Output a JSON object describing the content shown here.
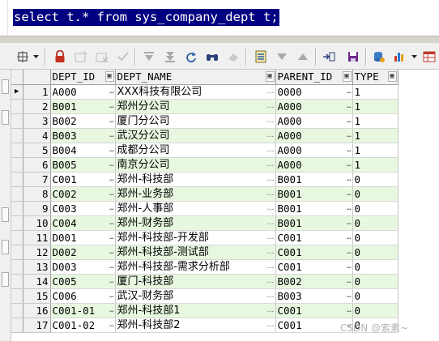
{
  "editor": {
    "sql": "select t.* from sys_company_dept t;"
  },
  "toolbar": {
    "icons": [
      "grid-options-icon",
      "lock-icon",
      "add-record-icon",
      "delete-record-icon",
      "post-changes-icon",
      "next-record-icon",
      "last-record-icon",
      "refresh-icon",
      "find-icon",
      "clear-icon",
      "query-by-example-icon",
      "filter-icon",
      "sort-icon",
      "export-icon",
      "save-icon",
      "fetch-icon",
      "chart-icon",
      "table-view-icon"
    ]
  },
  "grid": {
    "columns": [
      "DEPT_ID",
      "DEPT_NAME",
      "PARENT_ID",
      "TYPE"
    ],
    "rows": [
      {
        "n": "1",
        "dept_id": "A000",
        "dept_name": "XXX科技有限公司",
        "parent_id": "0000",
        "type": "1"
      },
      {
        "n": "2",
        "dept_id": "B001",
        "dept_name": "郑州分公司",
        "parent_id": "A000",
        "type": "1"
      },
      {
        "n": "3",
        "dept_id": "B002",
        "dept_name": "厦门分公司",
        "parent_id": "A000",
        "type": "1"
      },
      {
        "n": "4",
        "dept_id": "B003",
        "dept_name": "武汉分公司",
        "parent_id": "A000",
        "type": "1"
      },
      {
        "n": "5",
        "dept_id": "B004",
        "dept_name": "成都分公司",
        "parent_id": "A000",
        "type": "1"
      },
      {
        "n": "6",
        "dept_id": "B005",
        "dept_name": "南京分公司",
        "parent_id": "A000",
        "type": "1"
      },
      {
        "n": "7",
        "dept_id": "C001",
        "dept_name": "郑州-科技部",
        "parent_id": "B001",
        "type": "0"
      },
      {
        "n": "8",
        "dept_id": "C002",
        "dept_name": "郑州-业务部",
        "parent_id": "B001",
        "type": "0"
      },
      {
        "n": "9",
        "dept_id": "C003",
        "dept_name": "郑州-人事部",
        "parent_id": "B001",
        "type": "0"
      },
      {
        "n": "10",
        "dept_id": "C004",
        "dept_name": "郑州-财务部",
        "parent_id": "B001",
        "type": "0"
      },
      {
        "n": "11",
        "dept_id": "D001",
        "dept_name": "郑州-科技部-开发部",
        "parent_id": "C001",
        "type": "0"
      },
      {
        "n": "12",
        "dept_id": "D002",
        "dept_name": "郑州-科技部-测试部",
        "parent_id": "C001",
        "type": "0"
      },
      {
        "n": "13",
        "dept_id": "D003",
        "dept_name": "郑州-科技部-需求分析部",
        "parent_id": "C001",
        "type": "0"
      },
      {
        "n": "14",
        "dept_id": "C005",
        "dept_name": "厦门-科技部",
        "parent_id": "B002",
        "type": "0"
      },
      {
        "n": "15",
        "dept_id": "C006",
        "dept_name": "武汉-财务部",
        "parent_id": "B003",
        "type": "0"
      },
      {
        "n": "16",
        "dept_id": "C001-01",
        "dept_name": "郑州-科技部1",
        "parent_id": "C001",
        "type": "0"
      },
      {
        "n": "17",
        "dept_id": "C001-02",
        "dept_name": "郑州-科技部2",
        "parent_id": "C001",
        "type": "0"
      }
    ]
  },
  "watermark": "CSDN @索素~",
  "colors": {
    "selection": "#000080",
    "alt_row": "#e8f8e0",
    "chrome": "#f0f0f0"
  }
}
